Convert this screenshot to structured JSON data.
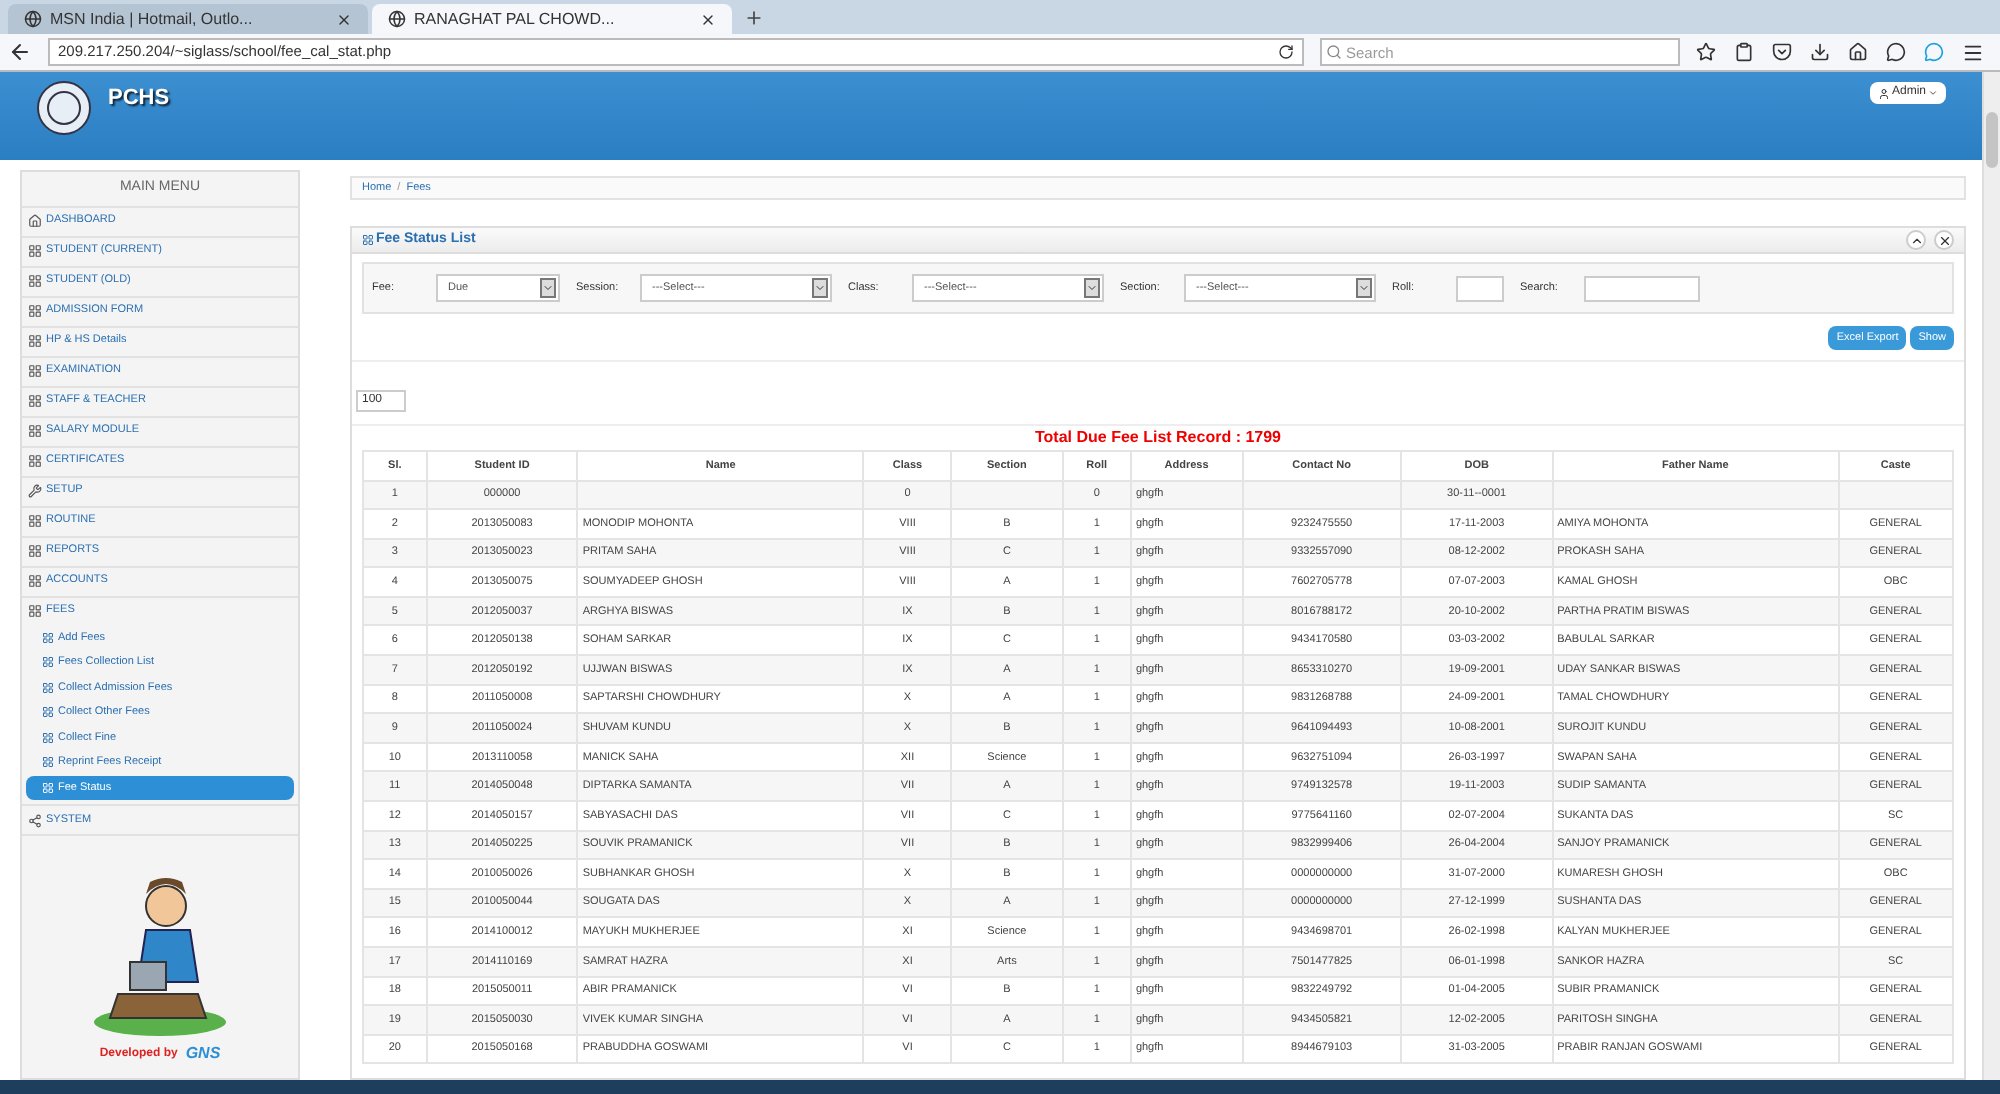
{
  "browser": {
    "tabs": [
      {
        "label": "MSN India | Hotmail, Outlo...",
        "selected": false
      },
      {
        "label": "RANAGHAT PAL CHOWD...",
        "selected": true
      }
    ],
    "address": "209.217.250.204/~siglass/school/fee_cal_stat.php",
    "search": {
      "placeholder": "Search"
    }
  },
  "header": {
    "logo_text": "PCHS",
    "user_button": "Admin"
  },
  "sidebar": {
    "title": "MAIN MENU",
    "items": [
      {
        "label": "DASHBOARD",
        "kind": "home",
        "selected": false
      },
      {
        "label": "STUDENT (CURRENT)",
        "kind": "grid",
        "selected": false
      },
      {
        "label": "STUDENT (OLD)",
        "kind": "grid",
        "selected": false
      },
      {
        "label": "ADMISSION FORM",
        "kind": "grid",
        "selected": false
      },
      {
        "label": "HP & HS Details",
        "kind": "grid",
        "selected": false
      },
      {
        "label": "EXAMINATION",
        "kind": "grid",
        "selected": false
      },
      {
        "label": "STAFF & TEACHER",
        "kind": "grid",
        "selected": false
      },
      {
        "label": "SALARY MODULE",
        "kind": "grid",
        "selected": false
      },
      {
        "label": "CERTIFICATES",
        "kind": "grid",
        "selected": false
      },
      {
        "label": "SETUP",
        "kind": "tool",
        "selected": false
      },
      {
        "label": "ROUTINE",
        "kind": "grid",
        "selected": false
      },
      {
        "label": "REPORTS",
        "kind": "grid",
        "selected": false
      },
      {
        "label": "ACCOUNTS",
        "kind": "grid",
        "selected": false
      },
      {
        "label": "FEES",
        "kind": "grid",
        "selected": false,
        "children": [
          {
            "label": "Add Fees",
            "selected": false
          },
          {
            "label": "Fees Collection List",
            "selected": false
          },
          {
            "label": "Collect Admission Fees",
            "selected": false
          },
          {
            "label": "Collect Other Fees",
            "selected": false
          },
          {
            "label": "Collect Fine",
            "selected": false
          },
          {
            "label": "Reprint Fees Receipt",
            "selected": false
          },
          {
            "label": "Fee Status",
            "selected": true
          }
        ]
      },
      {
        "label": "SYSTEM",
        "kind": "network",
        "selected": false
      }
    ],
    "credit": {
      "text": "Developed by",
      "logo": "GNS"
    }
  },
  "breadcrumb": {
    "items": [
      "Home",
      "Fees"
    ],
    "separator": "/"
  },
  "panel": {
    "title": "Fee Status List",
    "filters": [
      {
        "label": "Fee:",
        "kind": "select",
        "value": "Due"
      },
      {
        "label": "Session:",
        "kind": "select",
        "value": "---Select---"
      },
      {
        "label": "Class:",
        "kind": "select",
        "value": "---Select---"
      },
      {
        "label": "Section:",
        "kind": "select",
        "value": "---Select---"
      },
      {
        "label": "Roll:",
        "kind": "input"
      },
      {
        "label": "Search:",
        "kind": "input"
      }
    ],
    "buttons": [
      "Excel Export",
      "Show"
    ],
    "page_size": "100",
    "table_title": "Total Due Fee List Record : 1799",
    "columns": [
      "Sl.",
      "Student ID",
      "Name",
      "Class",
      "Section",
      "Roll",
      "Address",
      "Contact No",
      "DOB",
      "Father Name",
      "Caste"
    ],
    "rows": [
      {
        "sl": "1",
        "student_id": "000000",
        "class": "0",
        "roll": "0",
        "address": "ghgfh",
        "dob": "30-11--0001"
      },
      {
        "sl": "2",
        "student_id": "2013050083",
        "name": "MONODIP MOHONTA",
        "class": "VIII",
        "section": "B",
        "roll": "1",
        "address": "ghgfh",
        "contact": "9232475550",
        "dob": "17-11-2003",
        "father": "AMIYA MOHONTA",
        "caste": "GENERAL"
      },
      {
        "sl": "3",
        "student_id": "2013050023",
        "name": "PRITAM SAHA",
        "class": "VIII",
        "section": "C",
        "roll": "1",
        "address": "ghgfh",
        "contact": "9332557090",
        "dob": "08-12-2002",
        "father": "PROKASH SAHA",
        "caste": "GENERAL"
      },
      {
        "sl": "4",
        "student_id": "2013050075",
        "name": "SOUMYADEEP GHOSH",
        "class": "VIII",
        "section": "A",
        "roll": "1",
        "address": "ghgfh",
        "contact": "7602705778",
        "dob": "07-07-2003",
        "father": "KAMAL GHOSH",
        "caste": "OBC"
      },
      {
        "sl": "5",
        "student_id": "2012050037",
        "name": "ARGHYA BISWAS",
        "class": "IX",
        "section": "B",
        "roll": "1",
        "address": "ghgfh",
        "contact": "8016788172",
        "dob": "20-10-2002",
        "father": "PARTHA PRATIM BISWAS",
        "caste": "GENERAL"
      },
      {
        "sl": "6",
        "student_id": "2012050138",
        "name": "SOHAM SARKAR",
        "class": "IX",
        "section": "C",
        "roll": "1",
        "address": "ghgfh",
        "contact": "9434170580",
        "dob": "03-03-2002",
        "father": "BABULAL SARKAR",
        "caste": "GENERAL"
      },
      {
        "sl": "7",
        "student_id": "2012050192",
        "name": "UJJWAN BISWAS",
        "class": "IX",
        "section": "A",
        "roll": "1",
        "address": "ghgfh",
        "contact": "8653310270",
        "dob": "19-09-2001",
        "father": "UDAY SANKAR BISWAS",
        "caste": "GENERAL"
      },
      {
        "sl": "8",
        "student_id": "2011050008",
        "name": "SAPTARSHI CHOWDHURY",
        "class": "X",
        "section": "A",
        "roll": "1",
        "address": "ghgfh",
        "contact": "9831268788",
        "dob": "24-09-2001",
        "father": "TAMAL CHOWDHURY",
        "caste": "GENERAL"
      },
      {
        "sl": "9",
        "student_id": "2011050024",
        "name": "SHUVAM KUNDU",
        "class": "X",
        "section": "B",
        "roll": "1",
        "address": "ghgfh",
        "contact": "9641094493",
        "dob": "10-08-2001",
        "father": "SUROJIT KUNDU",
        "caste": "GENERAL"
      },
      {
        "sl": "10",
        "student_id": "2013110058",
        "name": "MANICK SAHA",
        "class": "XII",
        "section": "Science",
        "roll": "1",
        "address": "ghgfh",
        "contact": "9632751094",
        "dob": "26-03-1997",
        "father": "SWAPAN SAHA",
        "caste": "GENERAL"
      },
      {
        "sl": "11",
        "student_id": "2014050048",
        "name": "DIPTARKA SAMANTA",
        "class": "VII",
        "section": "A",
        "roll": "1",
        "address": "ghgfh",
        "contact": "9749132578",
        "dob": "19-11-2003",
        "father": "SUDIP SAMANTA",
        "caste": "GENERAL"
      },
      {
        "sl": "12",
        "student_id": "2014050157",
        "name": "SABYASACHI DAS",
        "class": "VII",
        "section": "C",
        "roll": "1",
        "address": "ghgfh",
        "contact": "9775641160",
        "dob": "02-07-2004",
        "father": "SUKANTA DAS",
        "caste": "SC"
      },
      {
        "sl": "13",
        "student_id": "2014050225",
        "name": "SOUVIK PRAMANICK",
        "class": "VII",
        "section": "B",
        "roll": "1",
        "address": "ghgfh",
        "contact": "9832999406",
        "dob": "26-04-2004",
        "father": "SANJOY PRAMANICK",
        "caste": "GENERAL"
      },
      {
        "sl": "14",
        "student_id": "2010050026",
        "name": "SUBHANKAR GHOSH",
        "class": "X",
        "section": "B",
        "roll": "1",
        "address": "ghgfh",
        "contact": "0000000000",
        "dob": "31-07-2000",
        "father": "KUMARESH GHOSH",
        "caste": "OBC"
      },
      {
        "sl": "15",
        "student_id": "2010050044",
        "name": "SOUGATA DAS",
        "class": "X",
        "section": "A",
        "roll": "1",
        "address": "ghgfh",
        "contact": "0000000000",
        "dob": "27-12-1999",
        "father": "SUSHANTA DAS",
        "caste": "GENERAL"
      },
      {
        "sl": "16",
        "student_id": "2014100012",
        "name": "MAYUKH MUKHERJEE",
        "class": "XI",
        "section": "Science",
        "roll": "1",
        "address": "ghgfh",
        "contact": "9434698701",
        "dob": "26-02-1998",
        "father": "KALYAN MUKHERJEE",
        "caste": "GENERAL"
      },
      {
        "sl": "17",
        "student_id": "2014110169",
        "name": "SAMRAT HAZRA",
        "class": "XI",
        "section": "Arts",
        "roll": "1",
        "address": "ghgfh",
        "contact": "7501477825",
        "dob": "06-01-1998",
        "father": "SANKOR HAZRA",
        "caste": "SC"
      },
      {
        "sl": "18",
        "student_id": "2015050011",
        "name": "ABIR PRAMANICK",
        "class": "VI",
        "section": "B",
        "roll": "1",
        "address": "ghgfh",
        "contact": "9832249792",
        "dob": "01-04-2005",
        "father": "SUBIR PRAMANICK",
        "caste": "GENERAL"
      },
      {
        "sl": "19",
        "student_id": "2015050030",
        "name": "VIVEK KUMAR SINGHA",
        "class": "VI",
        "section": "A",
        "roll": "1",
        "address": "ghgfh",
        "contact": "9434505821",
        "dob": "12-02-2005",
        "father": "PARITOSH SINGHA",
        "caste": "GENERAL"
      },
      {
        "sl": "20",
        "student_id": "2015050168",
        "name": "PRABUDDHA GOSWAMI",
        "class": "VI",
        "section": "C",
        "roll": "1",
        "address": "ghgfh",
        "contact": "8944679103",
        "dob": "31-03-2005",
        "father": "PRABIR RANJAN GOSWAMI",
        "caste": "GENERAL"
      }
    ]
  }
}
